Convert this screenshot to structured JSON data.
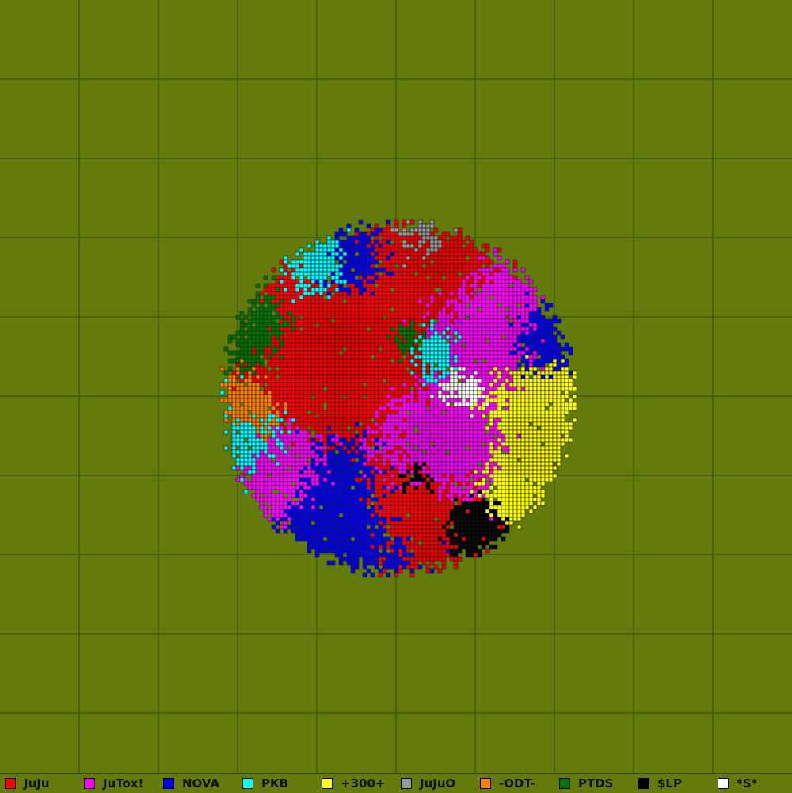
{
  "map": {
    "background_color": "#637b0b",
    "grid_color": "#2f4a10",
    "cell_border_color": "#1a1a1a",
    "grid_divisions": 10
  },
  "alliances": [
    {
      "id": "juju",
      "label": "JuJu",
      "color": "#ff0000"
    },
    {
      "id": "jutox",
      "label": "JuTox!",
      "color": "#ff00ff"
    },
    {
      "id": "nova",
      "label": "NOVA",
      "color": "#0000ff"
    },
    {
      "id": "pkb",
      "label": "PKB",
      "color": "#00ffff"
    },
    {
      "id": "300",
      "label": "+300+",
      "color": "#ffff00"
    },
    {
      "id": "jujuo",
      "label": "JuJuO",
      "color": "#999999"
    },
    {
      "id": "odt",
      "label": "-ODT-",
      "color": "#ff8000"
    },
    {
      "id": "ptds",
      "label": "PTDS",
      "color": "#007700"
    },
    {
      "id": "lp",
      "label": "$LP",
      "color": "#000000"
    },
    {
      "id": "s",
      "label": "*S*",
      "color": "#ffffff"
    }
  ]
}
